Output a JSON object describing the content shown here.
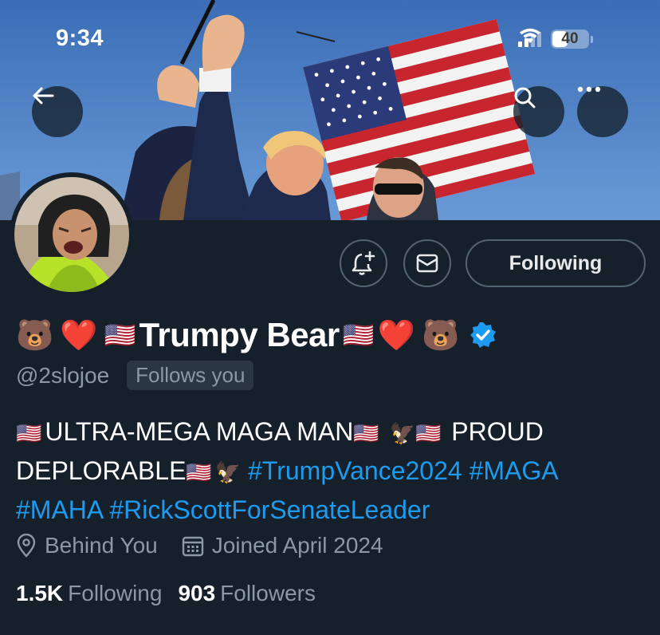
{
  "status_bar": {
    "time": "9:34",
    "battery": "40"
  },
  "profile": {
    "name_prefix_emoji": [
      "🐻",
      "❤️",
      "🇺🇸"
    ],
    "display_name": "Trumpy Bear",
    "name_suffix_emoji": [
      "🇺🇸",
      "❤️",
      "🐻"
    ],
    "verified": true,
    "handle": "@2slojoe",
    "follows_you_label": "Follows you",
    "bio": {
      "line1_part1": "ULTRA-MEGA MAGA MAN",
      "line1_part2": "PROUD",
      "line2_text": "DEPLORABLE",
      "hashtags": [
        "#TrumpVance2024",
        "#MAGA",
        "#MAHA",
        "#RickScottForSenateLeader"
      ]
    },
    "location": "Behind You",
    "joined": "Joined April 2024",
    "following_count": "1.5K",
    "following_label": "Following",
    "followers_count": "903",
    "followers_label": "Followers"
  },
  "buttons": {
    "following": "Following"
  },
  "icons": {
    "back": "arrow-left-icon",
    "search": "search-icon",
    "more": "more-icon",
    "notify": "bell-plus-icon",
    "message": "envelope-icon",
    "verified": "verified-badge-icon",
    "location": "location-pin-icon",
    "calendar": "calendar-icon"
  },
  "colors": {
    "background": "#15202b",
    "accent": "#1d9bf0",
    "muted": "#8b98a5",
    "border": "#536471"
  }
}
